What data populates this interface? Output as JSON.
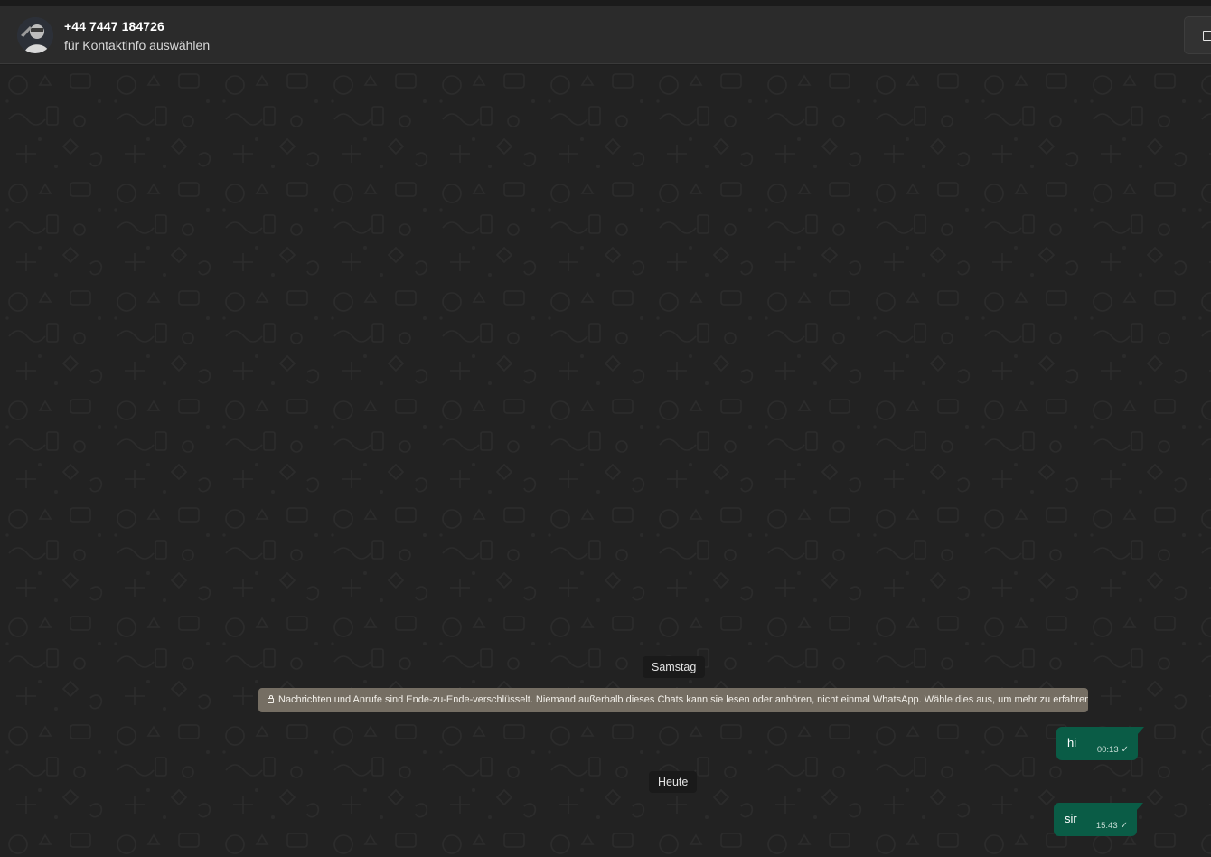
{
  "header": {
    "contact_name": "+44 7447 184726",
    "subtitle": "für Kontaktinfo auswählen"
  },
  "chat": {
    "date_saturday": "Samstag",
    "encryption_notice": "Nachrichten und Anrufe sind Ende-zu-Ende-verschlüsselt. Niemand außerhalb dieses Chats kann sie lesen oder anhören, nicht einmal WhatsApp. Wähle dies aus, um mehr zu erfahren.",
    "date_today": "Heute",
    "messages": [
      {
        "text": "hi",
        "time": "00:13",
        "status": "✓"
      },
      {
        "text": "sir",
        "time": "15:43",
        "status": "✓"
      }
    ]
  },
  "colors": {
    "header_bg": "#2b2b2b",
    "chat_bg": "#222222",
    "outgoing_bubble": "#0a5c46",
    "encryption_banner": "#756e63",
    "date_chip": "#1a1a1a"
  },
  "icons": [
    "lock-icon",
    "check-icon",
    "window-icon"
  ]
}
